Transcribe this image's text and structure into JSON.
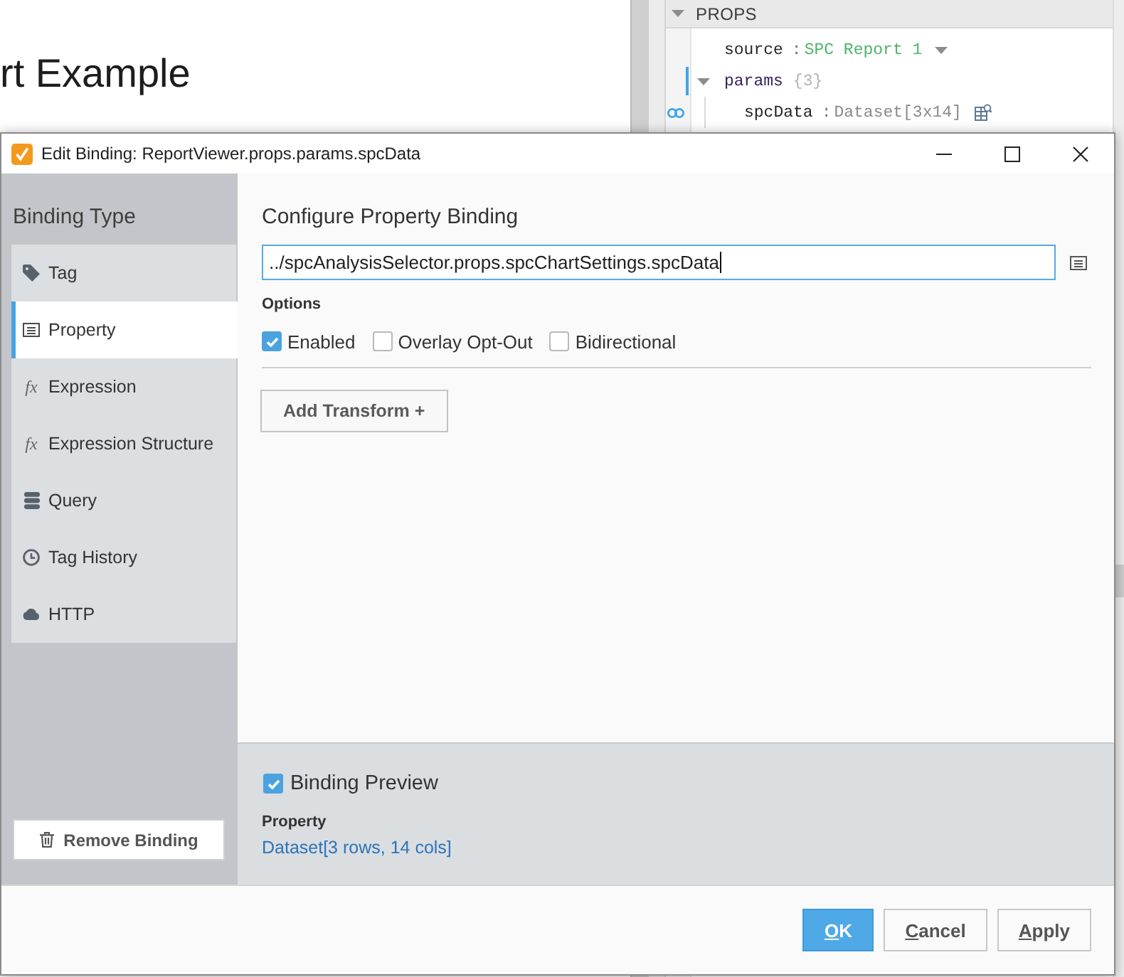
{
  "designer": {
    "canvas_title": "rt Example"
  },
  "props_panel": {
    "title": "PROPS",
    "expanded": true,
    "rows": [
      {
        "kind": "enum",
        "key": "source",
        "separator": ":",
        "value": "SPC Report 1",
        "selected": false,
        "bound": false
      },
      {
        "kind": "group",
        "key": "params",
        "count": "{3}",
        "expanded": true,
        "selected": true,
        "bound": false,
        "children": [
          {
            "kind": "dataset",
            "key": "spcData",
            "separator": ":",
            "value": "Dataset[3x14]",
            "selected": false,
            "bound": true
          }
        ]
      }
    ]
  },
  "dialog": {
    "title": "Edit Binding: ReportViewer.props.params.spcData",
    "sidebar": {
      "heading": "Binding Type",
      "items": [
        {
          "kind": "tag",
          "label": "Tag",
          "selected": false
        },
        {
          "kind": "property",
          "label": "Property",
          "selected": true
        },
        {
          "kind": "expression",
          "symbol": "fx",
          "label": "Expression",
          "selected": false
        },
        {
          "kind": "expression",
          "symbol": "fx",
          "label": "Expression Structure",
          "selected": false
        },
        {
          "kind": "query",
          "label": "Query",
          "selected": false
        },
        {
          "kind": "history",
          "label": "Tag History",
          "selected": false
        },
        {
          "kind": "http",
          "label": "HTTP",
          "selected": false
        }
      ],
      "remove_button": "Remove Binding"
    },
    "main": {
      "heading": "Configure Property Binding",
      "path_field": {
        "value": "../spcAnalysisSelector.props.spcChartSettings.spcData"
      },
      "options_label": "Options",
      "options": [
        {
          "label": "Enabled",
          "checked": true
        },
        {
          "label": "Overlay Opt-Out",
          "checked": false
        },
        {
          "label": "Bidirectional",
          "checked": false
        }
      ],
      "add_transform_button": "Add Transform +"
    },
    "preview": {
      "label": "Binding Preview",
      "checked": true,
      "property_label": "Property",
      "value": "Dataset[3 rows, 14 cols]"
    },
    "buttons": [
      {
        "kind": "primary",
        "label": "OK"
      },
      {
        "kind": "default",
        "label": "Cancel"
      },
      {
        "kind": "default",
        "label": "Apply"
      }
    ]
  }
}
